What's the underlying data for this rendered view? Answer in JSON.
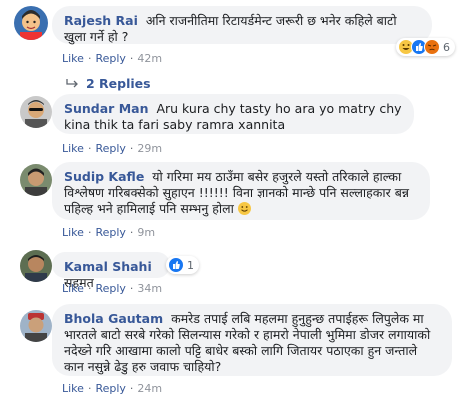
{
  "comments": [
    {
      "author": "Rajesh Rai",
      "text": "अनि राजनीतिमा रिटायर्डमेन्ट जरूरी छ भनेर कहिले बाटो खुला गर्ने हो ?",
      "like_label": "Like",
      "reply_label": "Reply",
      "time": "42m",
      "reaction_count": "6",
      "reaction_icons": [
        "haha-icon",
        "like-icon",
        "angry-icon"
      ]
    },
    {
      "author": "Sundar Man",
      "text": "Aru kura chy tasty ho ara yo matry chy kina thik ta fari saby ramra xannita",
      "like_label": "Like",
      "reply_label": "Reply",
      "time": "29m"
    },
    {
      "author": "Sudip Kafle",
      "text": "यो गरिमा मय ठाउँमा बसेर हजुरले यस्तो तरिकाले हाल्का विश्लेषण गरिबक्सेको सुहाएन !!!!!! विना ज्ञानको मान्छे पनि सल्लाहकार बन्न पहिल्ह भने हामिलाई पनि सम्भनु होला",
      "like_label": "Like",
      "reply_label": "Reply",
      "time": "9m"
    },
    {
      "author": "Kamal Shahi",
      "text": "सहमत",
      "like_label": "Like",
      "reply_label": "Reply",
      "time": "34m",
      "reaction_count": "1",
      "reaction_icons": [
        "like-icon"
      ]
    },
    {
      "author": "Bhola Gautam",
      "text": "कमरेड तपाई लबि महलमा हुनुहुन्छ तपाईहरू लिपुलेक मा भारतले बाटो सरबे गरेको सिलन्यास गरेको र हामरो नेपाली भुमिमा डोजर लगायाको नदेख्ने गरि आखामा कालो पट्टि बाधेर बस्को लागि जितायर पठाएका हुन जन्ताले कान नसुन्ने ढेडु हरु जवाफ चाहियो?",
      "like_label": "Like",
      "reply_label": "Reply",
      "time": "24m"
    }
  ],
  "replies_toggle": {
    "label": "2 Replies"
  },
  "colors": {
    "link": "#385898",
    "bubble": "#f2f3f5",
    "meta": "#606770"
  }
}
